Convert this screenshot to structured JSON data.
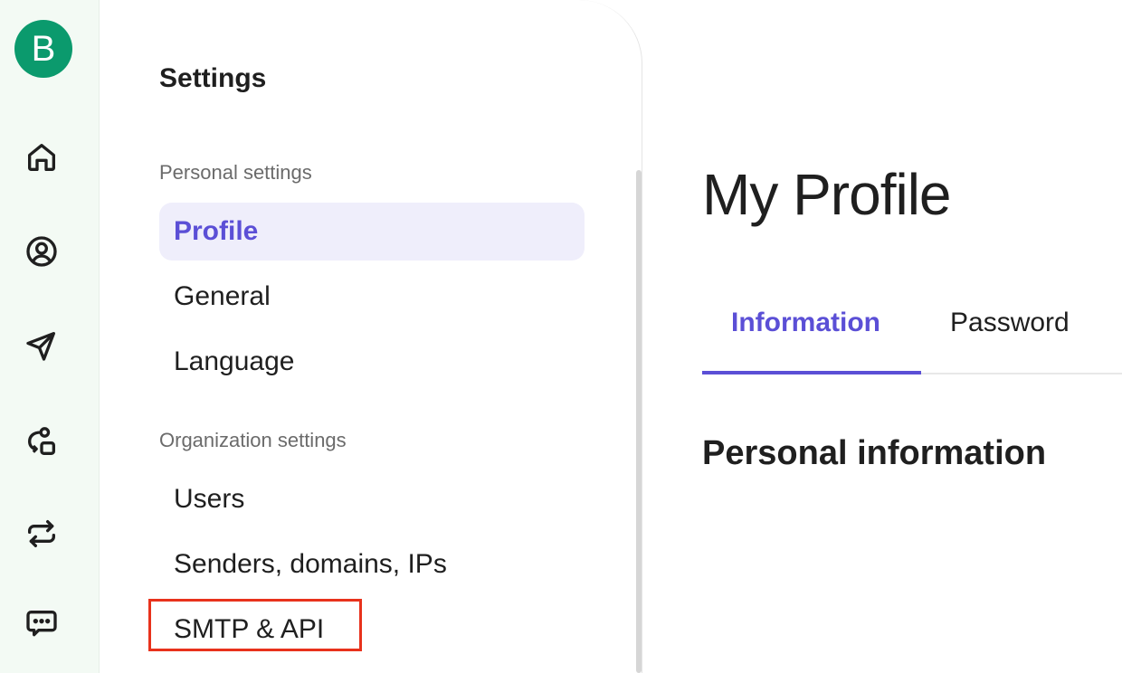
{
  "rail": {
    "logo_letter": "B",
    "logo_color": "#0b9a6d",
    "icons": [
      "home-icon",
      "user-circle-icon",
      "send-icon",
      "automation-icon",
      "transfer-icon",
      "chat-icon"
    ]
  },
  "settings": {
    "title": "Settings",
    "personal_label": "Personal settings",
    "personal_items": [
      "Profile",
      "General",
      "Language"
    ],
    "organization_label": "Organization settings",
    "organization_items": [
      "Users",
      "Senders, domains, IPs",
      "SMTP & API"
    ]
  },
  "main": {
    "title": "My Profile",
    "tabs": [
      "Information",
      "Password"
    ],
    "section_heading": "Personal information"
  },
  "colors": {
    "accent": "#5b4fd6",
    "active_bg": "#efeefb",
    "highlight": "#e8321c",
    "rail_bg": "#f3faf4"
  }
}
